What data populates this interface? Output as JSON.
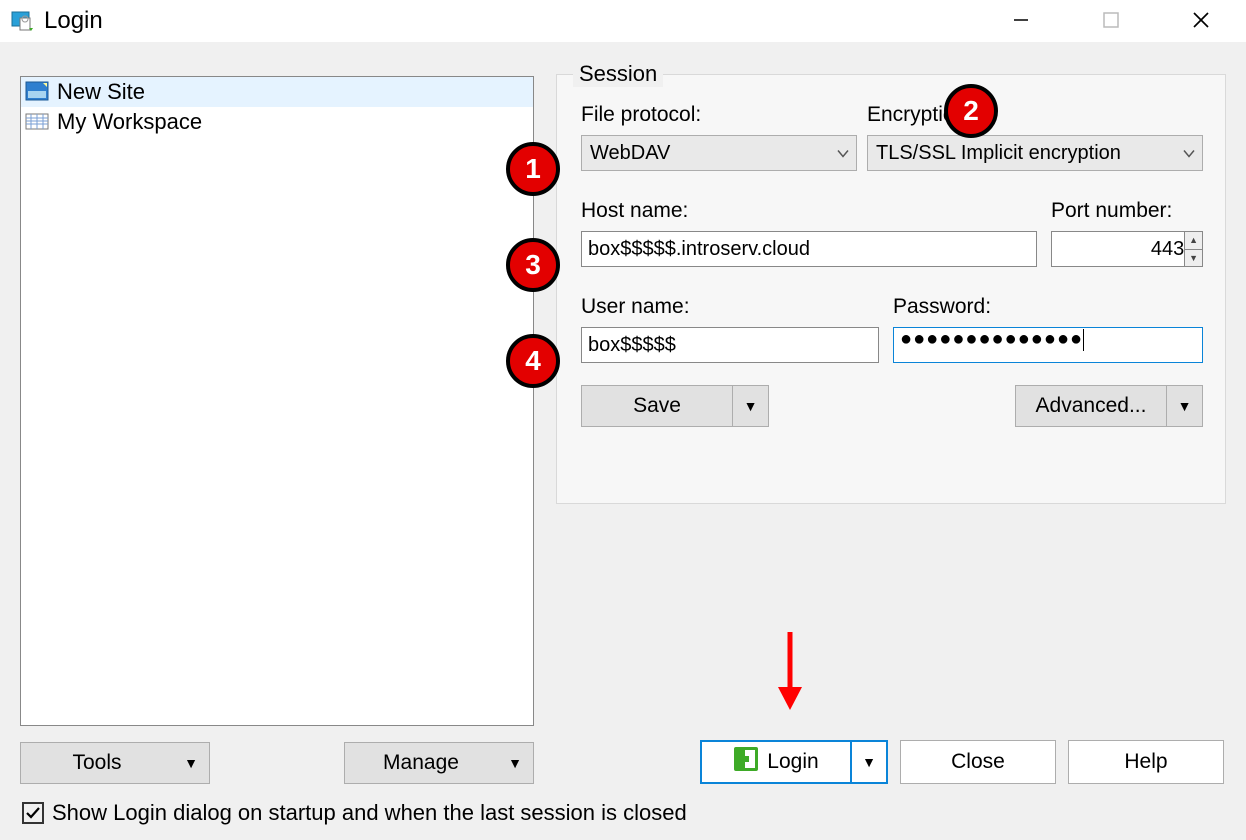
{
  "window": {
    "title": "Login"
  },
  "sites": {
    "items": [
      {
        "label": "New Site",
        "selected": true
      },
      {
        "label": "My Workspace",
        "selected": false
      }
    ]
  },
  "session": {
    "group_label": "Session",
    "file_protocol_label": "File protocol:",
    "file_protocol_value": "WebDAV",
    "encryption_label": "Encryption:",
    "encryption_value": "TLS/SSL Implicit encryption",
    "host_label": "Host name:",
    "host_value": "box$$$$$.introserv.cloud",
    "port_label": "Port number:",
    "port_value": "443",
    "user_label": "User name:",
    "user_value": "box$$$$$",
    "pass_label": "Password:",
    "pass_value": "●●●●●●●●●●●●●●",
    "save_label": "Save",
    "advanced_label": "Advanced..."
  },
  "footer": {
    "tools_label": "Tools",
    "manage_label": "Manage",
    "login_label": "Login",
    "close_label": "Close",
    "help_label": "Help",
    "show_startup_label": "Show Login dialog on startup and when the last session is closed",
    "show_startup_checked": true
  },
  "markers": {
    "m1": "1",
    "m2": "2",
    "m3": "3",
    "m4": "4"
  }
}
